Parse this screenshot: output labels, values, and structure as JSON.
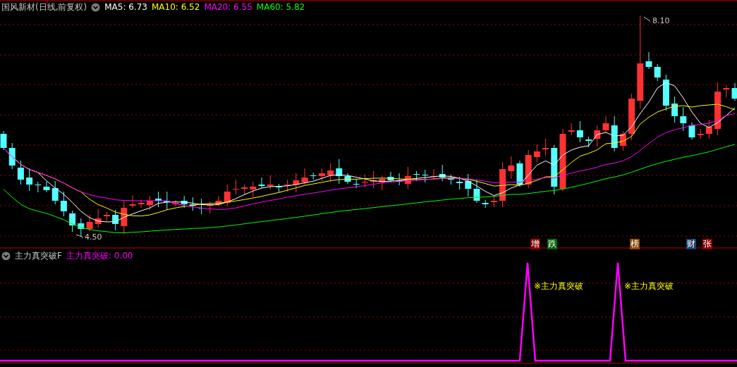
{
  "security": {
    "name": "国风新材(日线,前复权)"
  },
  "legend": [
    {
      "label": "MA5: 6.73",
      "color": "#ffffff"
    },
    {
      "label": "MA10: 6.52",
      "color": "#ffff00"
    },
    {
      "label": "MA20: 6.55",
      "color": "#ff00ff"
    },
    {
      "label": "MA60: 5.82",
      "color": "#00ff00"
    }
  ],
  "price_labels": [
    {
      "kind": "high",
      "text": "8.10"
    },
    {
      "kind": "low",
      "text": "4.50"
    }
  ],
  "event_tags": [
    {
      "text": "增",
      "color": "#8b0000"
    },
    {
      "text": "跌",
      "color": "#006400"
    },
    {
      "text": "榜",
      "color": "#8b4500"
    },
    {
      "text": "财",
      "color": "#1f3f6f"
    },
    {
      "text": "张",
      "color": "#8b0000"
    }
  ],
  "indicator": {
    "name": "主力真突破F",
    "reading": "主力真突破: 0.00",
    "signals": [
      {
        "text": "※主力真突破"
      },
      {
        "text": "※主力真突破"
      }
    ]
  }
}
